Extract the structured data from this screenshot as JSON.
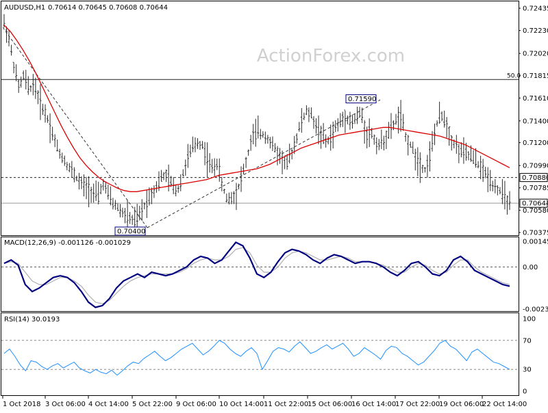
{
  "chart_data": [
    {
      "type": "candlestick",
      "title": "AUDUSD,H1",
      "ohlc_header": "0.70614 0.70645 0.70608 0.70644",
      "watermark": "ActionForex.com",
      "ylim": [
        0.70375,
        0.72435
      ],
      "price_ticks": [
        "0.72435",
        "0.72230",
        "0.72020",
        "0.71815",
        "0.71610",
        "0.71400",
        "0.71200",
        "0.70990",
        "0.70785",
        "0.70580",
        "0.70375"
      ],
      "x_labels": [
        "1 Oct 2018",
        "3 Oct 06:00",
        "4 Oct 14:00",
        "5 Oct 22:00",
        "9 Oct 06:00",
        "10 Oct 14:00",
        "11 Oct 22:00",
        "15 Oct 06:00",
        "16 Oct 14:00",
        "17 Oct 22:00",
        "19 Oct 06:00",
        "22 Oct 14:00"
      ],
      "close_series": [
        0.723,
        0.7215,
        0.719,
        0.717,
        0.7182,
        0.7168,
        0.7175,
        0.716,
        0.715,
        0.714,
        0.7125,
        0.7112,
        0.7105,
        0.7098,
        0.7092,
        0.7085,
        0.708,
        0.7078,
        0.7074,
        0.707,
        0.7083,
        0.7072,
        0.7064,
        0.706,
        0.7055,
        0.7052,
        0.7048,
        0.705,
        0.706,
        0.7068,
        0.7075,
        0.7082,
        0.709,
        0.7088,
        0.708,
        0.7076,
        0.709,
        0.7105,
        0.7115,
        0.712,
        0.7118,
        0.7105,
        0.7096,
        0.7102,
        0.708,
        0.7068,
        0.707,
        0.7075,
        0.709,
        0.7105,
        0.7125,
        0.713,
        0.7128,
        0.7126,
        0.7118,
        0.7112,
        0.7105,
        0.71,
        0.711,
        0.7125,
        0.714,
        0.7148,
        0.7145,
        0.7135,
        0.7128,
        0.712,
        0.7125,
        0.7135,
        0.714,
        0.7145,
        0.7138,
        0.7142,
        0.7148,
        0.7128,
        0.713,
        0.712,
        0.7118,
        0.7125,
        0.7132,
        0.714,
        0.7145,
        0.7125,
        0.7118,
        0.7108,
        0.71,
        0.7095,
        0.711,
        0.7132,
        0.7145,
        0.7142,
        0.7125,
        0.7118,
        0.7112,
        0.711,
        0.7108,
        0.7104,
        0.7098,
        0.7092,
        0.7086,
        0.708,
        0.7076,
        0.707,
        0.7064
      ],
      "ma_series": [
        0.7228,
        0.7222,
        0.7214,
        0.7205,
        0.7195,
        0.7184,
        0.7172,
        0.716,
        0.7148,
        0.7136,
        0.7125,
        0.7115,
        0.7106,
        0.7099,
        0.7093,
        0.7088,
        0.7084,
        0.7081,
        0.7078,
        0.7076,
        0.7075,
        0.7075,
        0.7076,
        0.7077,
        0.7078,
        0.7079,
        0.708,
        0.7081,
        0.7082,
        0.7083,
        0.7084,
        0.7085,
        0.7086,
        0.7088,
        0.709,
        0.7091,
        0.7092,
        0.7093,
        0.7094,
        0.7095,
        0.7096,
        0.7098,
        0.71,
        0.7103,
        0.7106,
        0.7109,
        0.7112,
        0.7115,
        0.7117,
        0.7119,
        0.7121,
        0.7123,
        0.7125,
        0.7127,
        0.7128,
        0.7129,
        0.713,
        0.7131,
        0.7132,
        0.7133,
        0.7134,
        0.7134,
        0.7133,
        0.7132,
        0.7131,
        0.713,
        0.7129,
        0.7128,
        0.7127,
        0.7126,
        0.7124,
        0.7122,
        0.712,
        0.7118,
        0.7115,
        0.7112,
        0.7109,
        0.7106,
        0.7103,
        0.71,
        0.7097
      ],
      "levels": [
        {
          "value": 0.7178,
          "label": "50.0",
          "style": "solid"
        },
        {
          "value": 0.7088,
          "label": "0.70880",
          "style": "dashed"
        },
        {
          "value": 0.70644,
          "label": "0.70644",
          "style": "solid-gray"
        }
      ],
      "annotations": [
        {
          "label": "0.71590",
          "value": 0.7159
        },
        {
          "label": "0.70400",
          "value": 0.704
        }
      ],
      "colors": {
        "candle": "#2a2a2a",
        "ma": "#dd0000",
        "level": "#555555",
        "trend": "#333333"
      }
    },
    {
      "type": "line",
      "title": "MACD(12,26,9) -0.001126 -0.001029",
      "ylim": [
        -0.002398,
        0.001454
      ],
      "ticks": [
        "0.001454",
        "0.00",
        "-0.002398"
      ],
      "zero_level": 0.0,
      "macd": [
        0.0002,
        0.0004,
        0.0001,
        -0.001,
        -0.0014,
        -0.0012,
        -0.0009,
        -0.0006,
        -0.0005,
        -0.0006,
        -0.0009,
        -0.0014,
        -0.002,
        -0.0023,
        -0.0022,
        -0.0018,
        -0.0012,
        -0.0008,
        -0.0006,
        -0.0004,
        -0.0006,
        -0.0003,
        -0.0004,
        -0.0005,
        -0.0004,
        -0.0002,
        0.0,
        0.0004,
        0.0006,
        0.0005,
        0.0002,
        0.0004,
        0.0009,
        0.0014,
        0.0012,
        0.0005,
        -0.0004,
        -0.0006,
        -0.0003,
        0.0003,
        0.0008,
        0.001,
        0.0009,
        0.0007,
        0.0004,
        0.0002,
        0.0005,
        0.0007,
        0.0006,
        0.0004,
        0.0002,
        0.0003,
        0.0003,
        0.0002,
        0.0,
        -0.0003,
        -0.0005,
        -0.0002,
        0.0002,
        0.0003,
        0.0,
        -0.0004,
        -0.0005,
        -0.0002,
        0.0004,
        0.0006,
        0.0003,
        -0.0002,
        -0.0004,
        -0.0006,
        -0.0008,
        -0.001,
        -0.0011
      ],
      "signal": [
        0.0002,
        0.0003,
        0.0002,
        -0.0003,
        -0.0008,
        -0.001,
        -0.001,
        -0.0008,
        -0.0006,
        -0.0006,
        -0.0008,
        -0.0011,
        -0.0016,
        -0.002,
        -0.0021,
        -0.0019,
        -0.0015,
        -0.0011,
        -0.0008,
        -0.0006,
        -0.0005,
        -0.0004,
        -0.0004,
        -0.0004,
        -0.0004,
        -0.0003,
        -0.0001,
        0.0002,
        0.0004,
        0.0005,
        0.0004,
        0.0004,
        0.0006,
        0.001,
        0.0011,
        0.0008,
        0.0001,
        -0.0003,
        -0.0003,
        0.0,
        0.0005,
        0.0008,
        0.0009,
        0.0008,
        0.0006,
        0.0004,
        0.0004,
        0.0005,
        0.0006,
        0.0005,
        0.0003,
        0.0003,
        0.0003,
        0.0002,
        0.0001,
        -0.0001,
        -0.0003,
        -0.0003,
        0.0,
        0.0002,
        0.0001,
        -0.0002,
        -0.0004,
        -0.0003,
        0.0001,
        0.0004,
        0.0004,
        0.0,
        -0.0003,
        -0.0005,
        -0.0007,
        -0.0009,
        -0.001
      ],
      "colors": {
        "macd": "#000080",
        "signal": "#b0b0b0",
        "zero": "#555555"
      }
    },
    {
      "type": "line",
      "title": "RSI(14) 30.0193",
      "ylim": [
        0,
        100
      ],
      "ticks": [
        "100",
        "70",
        "30",
        "0"
      ],
      "levels": [
        70,
        30
      ],
      "rsi": [
        52,
        58,
        48,
        36,
        28,
        42,
        40,
        34,
        30,
        35,
        38,
        32,
        36,
        40,
        32,
        28,
        25,
        30,
        26,
        24,
        29,
        22,
        28,
        35,
        40,
        38,
        45,
        50,
        55,
        48,
        42,
        46,
        52,
        58,
        62,
        66,
        58,
        50,
        55,
        62,
        70,
        66,
        58,
        52,
        48,
        55,
        60,
        52,
        30,
        42,
        55,
        60,
        58,
        54,
        62,
        68,
        60,
        52,
        55,
        60,
        64,
        58,
        62,
        66,
        58,
        48,
        52,
        60,
        55,
        50,
        44,
        56,
        62,
        60,
        52,
        48,
        42,
        36,
        40,
        48,
        56,
        66,
        70,
        62,
        58,
        50,
        42,
        54,
        58,
        52,
        46,
        40,
        38,
        34,
        30
      ],
      "colors": {
        "rsi": "#1e90ff",
        "level": "#888888"
      }
    }
  ]
}
